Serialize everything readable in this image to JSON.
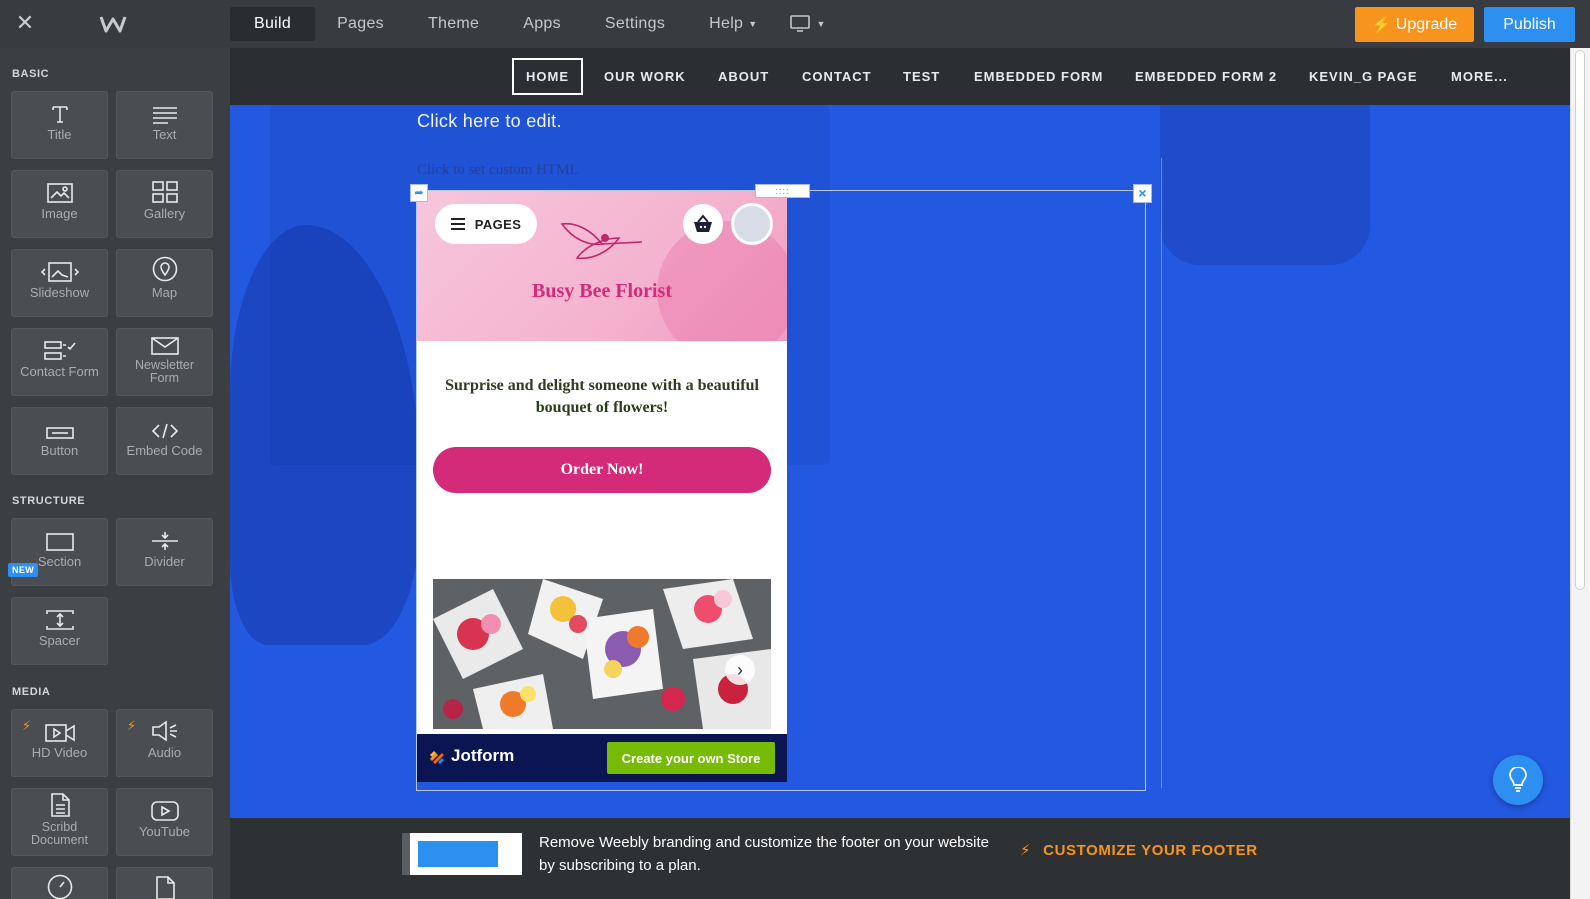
{
  "topbar": {
    "tabs": [
      {
        "label": "Build"
      },
      {
        "label": "Pages"
      },
      {
        "label": "Theme"
      },
      {
        "label": "Apps"
      },
      {
        "label": "Settings"
      },
      {
        "label": "Help"
      }
    ],
    "upgrade_label": "Upgrade",
    "publish_label": "Publish"
  },
  "sidebar": {
    "basic_heading": "BASIC",
    "structure_heading": "STRUCTURE",
    "media_heading": "MEDIA",
    "new_badge": "NEW",
    "tiles": {
      "title": "Title",
      "text": "Text",
      "image": "Image",
      "gallery": "Gallery",
      "slideshow": "Slideshow",
      "map": "Map",
      "contact_form": "Contact Form",
      "newsletter_1": "Newsletter",
      "newsletter_2": "Form",
      "button": "Button",
      "embed_code": "Embed Code",
      "section": "Section",
      "divider": "Divider",
      "spacer": "Spacer",
      "hd_video": "HD Video",
      "audio": "Audio",
      "scribd_1": "Scribd",
      "scribd_2": "Document",
      "youtube": "YouTube"
    }
  },
  "site_nav": {
    "items": [
      "HOME",
      "OUR WORK",
      "ABOUT",
      "CONTACT",
      "TEST",
      "EMBEDDED FORM",
      "EMBEDDED FORM 2",
      "KEVIN_G PAGE",
      "MORE..."
    ]
  },
  "canvas": {
    "edit_text": "Click here to edit.",
    "custom_html": "Click to set custom HTML"
  },
  "embed": {
    "pages_label": "PAGES",
    "brand": "Busy Bee Florist",
    "tagline": "Surprise and delight someone with a beautiful bouquet of flowers!",
    "order_label": "Order Now!",
    "jotform_label": "Jotform",
    "create_store_label": "Create your own Store"
  },
  "banner": {
    "text": "Remove Weebly branding and customize the footer on your website by subscribing to a plan.",
    "cta": "CUSTOMIZE YOUR FOOTER"
  },
  "colors": {
    "accent_orange": "#f7941d",
    "accent_blue": "#2d8ff0",
    "canvas_blue": "#2358e0",
    "brand_pink": "#d42a7a",
    "jotform_green": "#78bb07"
  }
}
